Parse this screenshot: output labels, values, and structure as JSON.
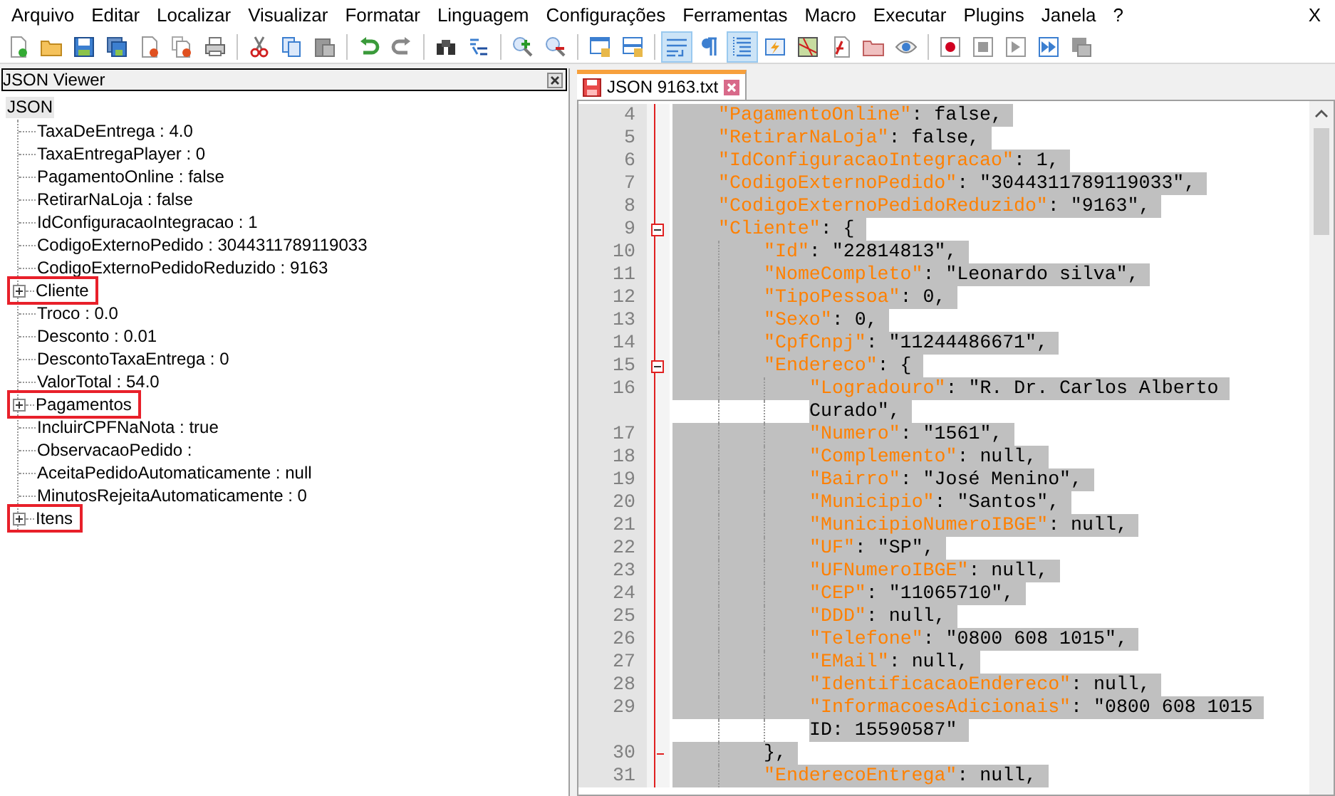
{
  "menu": {
    "items": [
      "Arquivo",
      "Editar",
      "Localizar",
      "Visualizar",
      "Formatar",
      "Linguagem",
      "Configurações",
      "Ferramentas",
      "Macro",
      "Executar",
      "Plugins",
      "Janela",
      "?"
    ],
    "close": "X"
  },
  "toolbar": [
    [
      {
        "selected": false
      },
      {
        "selected": false
      },
      {
        "selected": false
      },
      {
        "selected": false
      },
      {
        "selected": false
      },
      {
        "selected": false
      },
      {
        "selected": false
      }
    ],
    [
      {
        "selected": false
      },
      {
        "selected": false
      },
      {
        "selected": false
      }
    ],
    [
      {
        "selected": false
      },
      {
        "selected": false
      }
    ],
    [
      {
        "selected": false
      },
      {
        "selected": false
      }
    ],
    [
      {
        "selected": false
      },
      {
        "selected": false
      }
    ],
    [
      {
        "selected": false
      },
      {
        "selected": false
      }
    ],
    [
      {
        "selected": true
      },
      {
        "selected": false
      },
      {
        "selected": true
      },
      {
        "selected": false
      },
      {
        "selected": false
      },
      {
        "selected": false
      },
      {
        "selected": false
      },
      {
        "selected": false
      }
    ],
    [
      {
        "selected": false
      },
      {
        "selected": false
      },
      {
        "selected": false
      },
      {
        "selected": false
      },
      {
        "selected": false
      }
    ]
  ],
  "json_viewer": {
    "title": "JSON Viewer",
    "root": "JSON",
    "items": [
      {
        "label": "TaxaDeEntrega : 4.0",
        "expandable": false,
        "highlighted": false
      },
      {
        "label": "TaxaEntregaPlayer : 0",
        "expandable": false,
        "highlighted": false
      },
      {
        "label": "PagamentoOnline : false",
        "expandable": false,
        "highlighted": false
      },
      {
        "label": "RetirarNaLoja : false",
        "expandable": false,
        "highlighted": false
      },
      {
        "label": "IdConfiguracaoIntegracao : 1",
        "expandable": false,
        "highlighted": false
      },
      {
        "label": "CodigoExternoPedido : 3044311789119033",
        "expandable": false,
        "highlighted": false
      },
      {
        "label": "CodigoExternoPedidoReduzido : 9163",
        "expandable": false,
        "highlighted": false
      },
      {
        "label": "Cliente",
        "expandable": true,
        "highlighted": true
      },
      {
        "label": "Troco : 0.0",
        "expandable": false,
        "highlighted": false
      },
      {
        "label": "Desconto : 0.01",
        "expandable": false,
        "highlighted": false
      },
      {
        "label": "DescontoTaxaEntrega : 0",
        "expandable": false,
        "highlighted": false
      },
      {
        "label": "ValorTotal : 54.0",
        "expandable": false,
        "highlighted": false
      },
      {
        "label": "Pagamentos",
        "expandable": true,
        "highlighted": true
      },
      {
        "label": "IncluirCPFNaNota : true",
        "expandable": false,
        "highlighted": false
      },
      {
        "label": "ObservacaoPedido :",
        "expandable": false,
        "highlighted": false
      },
      {
        "label": "AceitaPedidoAutomaticamente : null",
        "expandable": false,
        "highlighted": false
      },
      {
        "label": "MinutosRejeitaAutomaticamente : 0",
        "expandable": false,
        "highlighted": false
      },
      {
        "label": "Itens",
        "expandable": true,
        "highlighted": true
      }
    ]
  },
  "editor": {
    "tab": {
      "label": "JSON 9163.txt",
      "selected": true
    },
    "lines": [
      {
        "number": "4",
        "key": "\"PagamentoOnline\"",
        "rest": ": false,"
      },
      {
        "number": "5",
        "key": "\"RetirarNaLoja\"",
        "rest": ": false,"
      },
      {
        "number": "6",
        "key": "\"IdConfiguracaoIntegracao\"",
        "rest": ": 1,"
      },
      {
        "number": "7",
        "key": "\"CodigoExternoPedido\"",
        "rest": ": \"3044311789119033\","
      },
      {
        "number": "8",
        "key": "\"CodigoExternoPedidoReduzido\"",
        "rest": ": \"9163\","
      },
      {
        "number": "9",
        "key": "\"Cliente\"",
        "rest": ": {",
        "expanded": true,
        "children": [
          {
            "number": "10",
            "key": "\"Id\"",
            "rest": ": \"22814813\","
          },
          {
            "number": "11",
            "key": "\"NomeCompleto\"",
            "rest": ": \"Leonardo silva\","
          },
          {
            "number": "12",
            "key": "\"TipoPessoa\"",
            "rest": ": 0,"
          },
          {
            "number": "13",
            "key": "\"Sexo\"",
            "rest": ": 0,"
          },
          {
            "number": "14",
            "key": "\"CpfCnpj\"",
            "rest": ": \"11244486671\","
          },
          {
            "number": "15",
            "key": "\"Endereco\"",
            "rest": ": {",
            "expanded": true,
            "children": [
              {
                "number": "16",
                "key": "\"Logradouro\"",
                "rest": ": \"R. Dr. Carlos Alberto",
                "wrap": "Curado\","
              },
              {
                "number": "17",
                "key": "\"Numero\"",
                "rest": ": \"1561\","
              },
              {
                "number": "18",
                "key": "\"Complemento\"",
                "rest": ": null,"
              },
              {
                "number": "19",
                "key": "\"Bairro\"",
                "rest": ": \"José Menino\","
              },
              {
                "number": "20",
                "key": "\"Municipio\"",
                "rest": ": \"Santos\","
              },
              {
                "number": "21",
                "key": "\"MunicipioNumeroIBGE\"",
                "rest": ": null,"
              },
              {
                "number": "22",
                "key": "\"UF\"",
                "rest": ": \"SP\","
              },
              {
                "number": "23",
                "key": "\"UFNumeroIBGE\"",
                "rest": ": null,"
              },
              {
                "number": "24",
                "key": "\"CEP\"",
                "rest": ": \"11065710\","
              },
              {
                "number": "25",
                "key": "\"DDD\"",
                "rest": ": null,"
              },
              {
                "number": "26",
                "key": "\"Telefone\"",
                "rest": ": \"0800 608 1015\","
              },
              {
                "number": "27",
                "key": "\"EMail\"",
                "rest": ": null,"
              },
              {
                "number": "28",
                "key": "\"IdentificacaoEndereco\"",
                "rest": ": null,"
              },
              {
                "number": "29",
                "key": "\"InformacoesAdicionais\"",
                "rest": ": \"0800 608 1015",
                "wrap": "ID: 15590587\""
              }
            ]
          },
          {
            "number": "30",
            "rest": "},"
          },
          {
            "number": "31",
            "key": "\"EnderecoEntrega\"",
            "rest": ": null,"
          }
        ]
      }
    ]
  }
}
